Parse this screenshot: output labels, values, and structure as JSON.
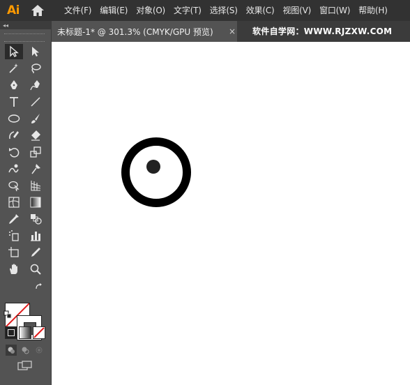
{
  "app": {
    "logo": "Ai",
    "home_icon": "home-icon"
  },
  "menu": [
    "文件(F)",
    "编辑(E)",
    "对象(O)",
    "文字(T)",
    "选择(S)",
    "效果(C)",
    "视图(V)",
    "窗口(W)",
    "帮助(H)"
  ],
  "toolbar": {
    "collapse_label": "◂◂",
    "tools": [
      "selection-tool",
      "direct-selection-tool",
      "magic-wand-tool",
      "lasso-tool",
      "pen-tool",
      "curvature-tool",
      "type-tool",
      "line-segment-tool",
      "ellipse-tool",
      "paintbrush-tool",
      "shaper-tool",
      "eraser-tool",
      "rotate-tool",
      "scale-tool",
      "warp-tool",
      "puppet-warp-tool",
      "shape-builder-tool",
      "perspective-grid-tool",
      "mesh-tool",
      "gradient-tool",
      "eyedropper-tool",
      "blend-tool",
      "symbol-sprayer-tool",
      "column-graph-tool",
      "artboard-tool",
      "slice-tool",
      "hand-tool",
      "zoom-tool"
    ],
    "active_tool": "selection-tool",
    "fill": "none",
    "stroke_color": "#535353"
  },
  "document": {
    "tab_title": "未标题-1* @ 301.3% (CMYK/GPU 预览)",
    "close": "×",
    "watermark": "软件自学网：WWW.RJZXW.COM"
  },
  "artwork": {
    "ring_color": "#000000",
    "dot_color": "#222222"
  }
}
